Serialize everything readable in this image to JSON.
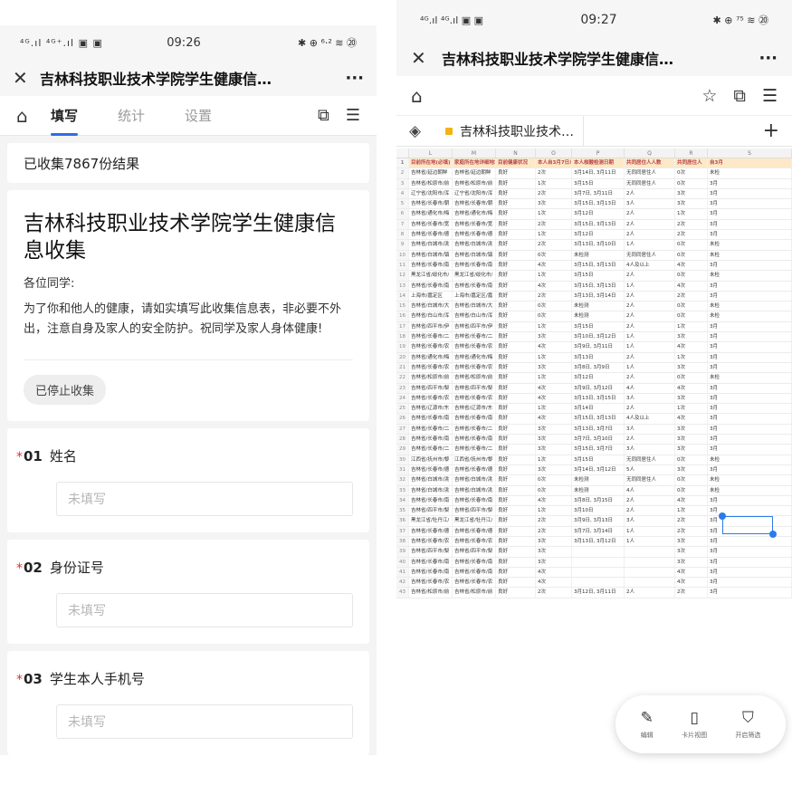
{
  "left": {
    "status": {
      "signal": "⁴ᴳ.ıl ⁴ᴳ⁺.ıl ▣ ▣",
      "time": "09:26",
      "right": "✱ ⊕ ⁶·²  ≋ ⑳"
    },
    "title": "吉林科技职业技术学院学生健康信…",
    "tabs": [
      "填写",
      "统计",
      "设置"
    ],
    "collected": "已收集7867份结果",
    "form_title": "吉林科技职业技术学院学生健康信息收集",
    "greeting": "各位同学:",
    "description": "为了你和他人的健康，请如实填写此收集信息表，非必要不外出，注意自身及家人的安全防护。祝同学及家人身体健康!",
    "stopped_label": "已停止收集",
    "questions": [
      {
        "required": "*",
        "num": "01",
        "label": "姓名",
        "placeholder": "未填写"
      },
      {
        "required": "*",
        "num": "02",
        "label": "身份证号",
        "placeholder": "未填写"
      },
      {
        "required": "*",
        "num": "03",
        "label": "学生本人手机号",
        "placeholder": "未填写"
      }
    ]
  },
  "right": {
    "status": {
      "signal": "⁴ᴳ.ıl ⁴ᴳ.ıl ▣ ▣",
      "time": "09:27",
      "right": "✱ ⊕ ⁷⁵ ≋ ⑳"
    },
    "title": "吉林科技职业技术学院学生健康信…",
    "sheet_tab": "吉林科技职业技术…",
    "columns": [
      "",
      "L",
      "M",
      "N",
      "O",
      "P",
      "Q",
      "R",
      "S"
    ],
    "header_row": [
      "1",
      "目前所在地(必填)",
      "家庭所在地详细地址",
      "目前健康状况",
      "本人自3月7日以来",
      "本人核酸检测日期",
      "共同居住人人数",
      "共同居住人",
      "自3月"
    ],
    "rows": [
      [
        "2",
        "吉林省/延边朝鲜",
        "吉林省/延边朝鲜",
        "良好",
        "2次",
        "3月14日, 3月11日",
        "无同同居住人",
        "0次",
        "未检"
      ],
      [
        "3",
        "吉林省/松原市/前",
        "吉林省/松原市/前",
        "良好",
        "1次",
        "3月15日",
        "无同同居住人",
        "0次",
        "3月"
      ],
      [
        "4",
        "辽宁省/沈阳市/浑",
        "辽宁省/沈阳市/浑",
        "良好",
        "2次",
        "3月7日, 3月11日",
        "2人",
        "3次",
        "3月"
      ],
      [
        "5",
        "吉林省/长春市/朝",
        "吉林省/长春市/朝",
        "良好",
        "3次",
        "3月15日, 3月13日",
        "3人",
        "3次",
        "3月"
      ],
      [
        "6",
        "吉林省/通化市/梅",
        "吉林省/通化市/梅",
        "良好",
        "1次",
        "3月12日",
        "2人",
        "1次",
        "3月"
      ],
      [
        "7",
        "吉林省/长春市/宽",
        "吉林省/长春市/宽",
        "良好",
        "2次",
        "3月15日, 3月13日",
        "2人",
        "2次",
        "3月"
      ],
      [
        "8",
        "吉林省/长春市/德",
        "吉林省/长春市/德",
        "良好",
        "1次",
        "3月12日",
        "2人",
        "2次",
        "3月"
      ],
      [
        "9",
        "吉林省/白城市/洮",
        "吉林省/白城市/洮",
        "良好",
        "2次",
        "3月13日, 3月10日",
        "1人",
        "0次",
        "未检"
      ],
      [
        "10",
        "吉林省/白城市/镇",
        "吉林省/白城市/镇",
        "良好",
        "0次",
        "未检测",
        "无同同居住人",
        "0次",
        "未检"
      ],
      [
        "11",
        "吉林省/长春市/南",
        "吉林省/长春市/南",
        "良好",
        "4次",
        "3月15日, 3月13日",
        "4人及以上",
        "4次",
        "3月"
      ],
      [
        "12",
        "黑龙江省/绥化市/",
        "黑龙江省/绥化市/",
        "良好",
        "1次",
        "3月15日",
        "2人",
        "0次",
        "未检"
      ],
      [
        "13",
        "吉林省/长春市/南",
        "吉林省/长春市/南",
        "良好",
        "4次",
        "3月15日, 3月13日",
        "1人",
        "4次",
        "3月"
      ],
      [
        "14",
        "上海市/嘉定区",
        "上海市/嘉定区/嘉",
        "良好",
        "2次",
        "3月13日, 3月14日",
        "2人",
        "2次",
        "3月"
      ],
      [
        "15",
        "吉林省/白城市/大",
        "吉林省/白城市/大",
        "良好",
        "0次",
        "未检测",
        "2人",
        "0次",
        "未检"
      ],
      [
        "16",
        "吉林省/白山市/浑",
        "吉林省/白山市/浑",
        "良好",
        "0次",
        "未检测",
        "2人",
        "0次",
        "未检"
      ],
      [
        "17",
        "吉林省/四平市/伊",
        "吉林省/四平市/伊",
        "良好",
        "1次",
        "3月15日",
        "2人",
        "1次",
        "3月"
      ],
      [
        "18",
        "吉林省/长春市/二",
        "吉林省/长春市/二",
        "良好",
        "3次",
        "3月10日, 3月12日",
        "1人",
        "3次",
        "3月"
      ],
      [
        "19",
        "吉林省/长春市/农",
        "吉林省/长春市/农",
        "良好",
        "4次",
        "3月9日, 3月11日",
        "1人",
        "4次",
        "3月"
      ],
      [
        "20",
        "吉林省/通化市/梅",
        "吉林省/通化市/梅",
        "良好",
        "1次",
        "3月13日",
        "2人",
        "1次",
        "3月"
      ],
      [
        "21",
        "吉林省/长春市/农",
        "吉林省/长春市/农",
        "良好",
        "3次",
        "3月8日, 3月9日",
        "1人",
        "3次",
        "3月"
      ],
      [
        "22",
        "吉林省/松原市/前",
        "吉林省/松原市/前",
        "良好",
        "1次",
        "3月12日",
        "2人",
        "0次",
        "未检"
      ],
      [
        "23",
        "吉林省/四平市/梨",
        "吉林省/四平市/梨",
        "良好",
        "4次",
        "3月9日, 3月12日",
        "4人",
        "4次",
        "3月"
      ],
      [
        "24",
        "吉林省/长春市/农",
        "吉林省/长春市/农",
        "良好",
        "4次",
        "3月13日, 3月15日",
        "3人",
        "3次",
        "3月"
      ],
      [
        "25",
        "吉林省/辽源市/东",
        "吉林省/辽源市/东",
        "良好",
        "1次",
        "3月14日",
        "2人",
        "1次",
        "3月"
      ],
      [
        "26",
        "吉林省/长春市/南",
        "吉林省/长春市/南",
        "良好",
        "4次",
        "3月15日, 3月13日",
        "4人及以上",
        "4次",
        "3月"
      ],
      [
        "27",
        "吉林省/长春市/二",
        "吉林省/长春市/二",
        "良好",
        "3次",
        "3月13日, 3月7日",
        "3人",
        "3次",
        "3月"
      ],
      [
        "28",
        "吉林省/长春市/南",
        "吉林省/长春市/南",
        "良好",
        "3次",
        "3月7日, 3月10日",
        "2人",
        "3次",
        "3月"
      ],
      [
        "29",
        "吉林省/长春市/二",
        "吉林省/长春市/二",
        "良好",
        "3次",
        "3月15日, 3月7日",
        "3人",
        "3次",
        "3月"
      ],
      [
        "30",
        "江西省/抚州市/黎",
        "江西省/抚州市/黎",
        "良好",
        "1次",
        "3月15日",
        "无同同居住人",
        "0次",
        "未检"
      ],
      [
        "31",
        "吉林省/长春市/德",
        "吉林省/长春市/德",
        "良好",
        "3次",
        "3月14日, 3月12日",
        "5人",
        "3次",
        "3月"
      ],
      [
        "32",
        "吉林省/白城市/洮",
        "吉林省/白城市/洮",
        "良好",
        "0次",
        "未检测",
        "无同同居住人",
        "0次",
        "未检"
      ],
      [
        "33",
        "吉林省/白城市/洮",
        "吉林省/白城市/洮",
        "良好",
        "0次",
        "未检测",
        "4人",
        "0次",
        "未检"
      ],
      [
        "34",
        "吉林省/长春市/南",
        "吉林省/长春市/南",
        "良好",
        "4次",
        "3月8日, 3月15日",
        "2人",
        "4次",
        "3月"
      ],
      [
        "35",
        "吉林省/四平市/梨",
        "吉林省/四平市/梨",
        "良好",
        "1次",
        "3月10日",
        "2人",
        "1次",
        "3月"
      ],
      [
        "36",
        "黑龙江省/牡丹江/",
        "黑龙江省/牡丹江/",
        "良好",
        "2次",
        "3月9日, 3月13日",
        "3人",
        "2次",
        "3月"
      ],
      [
        "37",
        "吉林省/长春市/德",
        "吉林省/长春市/德",
        "良好",
        "2次",
        "3月7日, 3月14日",
        "1人",
        "2次",
        "3月"
      ],
      [
        "38",
        "吉林省/长春市/农",
        "吉林省/长春市/农",
        "良好",
        "3次",
        "3月13日, 3月12日",
        "1人",
        "3次",
        "3月"
      ],
      [
        "39",
        "吉林省/四平市/梨",
        "吉林省/四平市/梨",
        "良好",
        "3次",
        "",
        "",
        "3次",
        "3月"
      ],
      [
        "40",
        "吉林省/长春市/南",
        "吉林省/长春市/南",
        "良好",
        "3次",
        "",
        "",
        "3次",
        "3月"
      ],
      [
        "41",
        "吉林省/长春市/南",
        "吉林省/长春市/南",
        "良好",
        "4次",
        "",
        "",
        "4次",
        "3月"
      ],
      [
        "42",
        "吉林省/长春市/农",
        "吉林省/长春市/农",
        "良好",
        "4次",
        "",
        "",
        "4次",
        "3月"
      ],
      [
        "43",
        "吉林省/松原市/前",
        "吉林省/松原市/前",
        "良好",
        "2次",
        "3月12日, 3月11日",
        "2人",
        "2次",
        "3月"
      ]
    ],
    "fab": [
      {
        "icon": "✎",
        "label": "编辑"
      },
      {
        "icon": "▯",
        "label": "卡片视图"
      },
      {
        "icon": "⛉",
        "label": "开启筛选"
      }
    ]
  }
}
